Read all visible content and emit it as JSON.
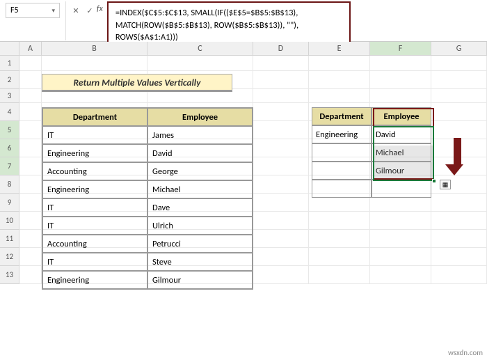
{
  "cellRef": "F5",
  "formula": {
    "line1": "=INDEX($C$5:$C$13, SMALL(IF(($E$5=$B$5:$B$13),",
    "line2": "MATCH(ROW($B$5:$B$13), ROW($B$5:$B$13)), \"\"),",
    "line3": "ROWS($A$1:A1)))"
  },
  "cols": {
    "A": "A",
    "B": "B",
    "C": "C",
    "D": "D",
    "E": "E",
    "F": "F",
    "G": "G"
  },
  "rows": {
    "r1": "1",
    "r2": "2",
    "r3": "3",
    "r4": "4",
    "r5": "5",
    "r6": "6",
    "r7": "7",
    "r8": "8",
    "r9": "9",
    "r10": "10",
    "r11": "11",
    "r12": "12",
    "r13": "13"
  },
  "title": "Return Multiple Values Vertically",
  "mainTable": {
    "headers": {
      "dept": "Department",
      "emp": "Employee"
    },
    "rows": [
      {
        "dept": "IT",
        "emp": "James"
      },
      {
        "dept": "Engineering",
        "emp": "David"
      },
      {
        "dept": "Accounting",
        "emp": "George"
      },
      {
        "dept": "Engineering",
        "emp": "Michael"
      },
      {
        "dept": "IT",
        "emp": "Dave"
      },
      {
        "dept": "IT",
        "emp": "Ulrich"
      },
      {
        "dept": "Accounting",
        "emp": "Petrucci"
      },
      {
        "dept": "IT",
        "emp": "Steve"
      },
      {
        "dept": "Engineering",
        "emp": "Gilmour"
      }
    ]
  },
  "rightTable": {
    "headers": {
      "dept": "Department",
      "emp": "Employee"
    },
    "rows": [
      {
        "dept": "Engineering",
        "emp": "David"
      },
      {
        "dept": "",
        "emp": "Michael"
      },
      {
        "dept": "",
        "emp": "Gilmour"
      },
      {
        "dept": "",
        "emp": ""
      }
    ]
  },
  "watermark": "wsxdn.com",
  "icons": {
    "dropdown": "▾",
    "cancel": "✕",
    "confirm": "✓",
    "fx": "fx",
    "autofill": "▦"
  }
}
